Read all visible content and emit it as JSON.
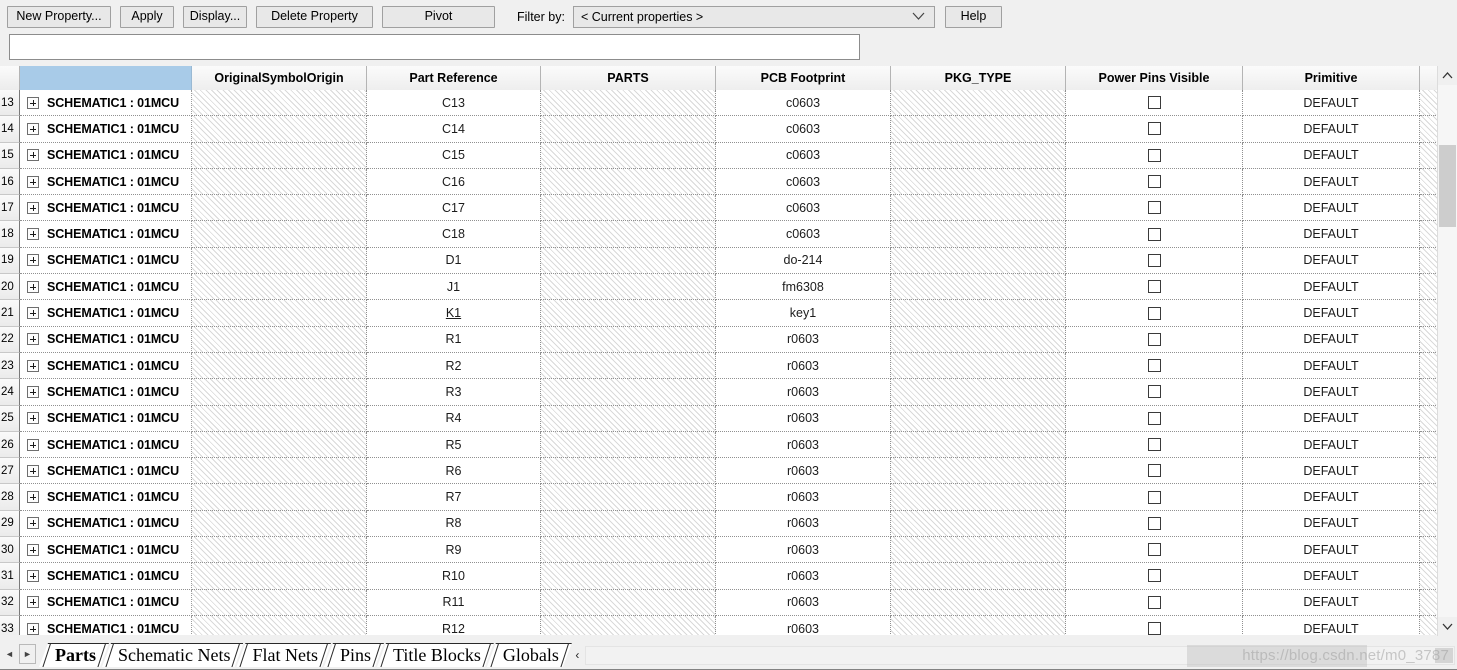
{
  "toolbar": {
    "new_property_label": "New Property...",
    "apply_label": "Apply",
    "display_label": "Display...",
    "delete_property_label": "Delete Property",
    "pivot_label": "Pivot",
    "filter_by_label": "Filter by:",
    "filter_value": "< Current properties >",
    "help_label": "Help"
  },
  "editbar": {
    "value": "",
    "placeholder": ""
  },
  "grid": {
    "columns": [
      {
        "key": "rownum",
        "label": ""
      },
      {
        "key": "name",
        "label": ""
      },
      {
        "key": "origin",
        "label": "OriginalSymbolOrigin"
      },
      {
        "key": "partref",
        "label": "Part Reference"
      },
      {
        "key": "parts",
        "label": "PARTS"
      },
      {
        "key": "footprint",
        "label": "PCB Footprint"
      },
      {
        "key": "pkgtype",
        "label": "PKG_TYPE"
      },
      {
        "key": "powerpins",
        "label": "Power Pins Visible"
      },
      {
        "key": "primitive",
        "label": "Primitive"
      }
    ],
    "rows": [
      {
        "num": "13",
        "name": "SCHEMATIC1 : 01MCU",
        "partref": "C13",
        "footprint": "c0603",
        "primitive": "DEFAULT",
        "selected": false
      },
      {
        "num": "14",
        "name": "SCHEMATIC1 : 01MCU",
        "partref": "C14",
        "footprint": "c0603",
        "primitive": "DEFAULT",
        "selected": false
      },
      {
        "num": "15",
        "name": "SCHEMATIC1 : 01MCU",
        "partref": "C15",
        "footprint": "c0603",
        "primitive": "DEFAULT",
        "selected": false
      },
      {
        "num": "16",
        "name": "SCHEMATIC1 : 01MCU",
        "partref": "C16",
        "footprint": "c0603",
        "primitive": "DEFAULT",
        "selected": false
      },
      {
        "num": "17",
        "name": "SCHEMATIC1 : 01MCU",
        "partref": "C17",
        "footprint": "c0603",
        "primitive": "DEFAULT",
        "selected": false
      },
      {
        "num": "18",
        "name": "SCHEMATIC1 : 01MCU",
        "partref": "C18",
        "footprint": "c0603",
        "primitive": "DEFAULT",
        "selected": false
      },
      {
        "num": "19",
        "name": "SCHEMATIC1 : 01MCU",
        "partref": "D1",
        "footprint": "do-214",
        "primitive": "DEFAULT",
        "selected": false
      },
      {
        "num": "20",
        "name": "SCHEMATIC1 : 01MCU",
        "partref": "J1",
        "footprint": "fm6308",
        "primitive": "DEFAULT",
        "selected": false
      },
      {
        "num": "21",
        "name": "SCHEMATIC1 : 01MCU",
        "partref": "K1",
        "footprint": "key1",
        "primitive": "DEFAULT",
        "selected": true
      },
      {
        "num": "22",
        "name": "SCHEMATIC1 : 01MCU",
        "partref": "R1",
        "footprint": "r0603",
        "primitive": "DEFAULT",
        "selected": false
      },
      {
        "num": "23",
        "name": "SCHEMATIC1 : 01MCU",
        "partref": "R2",
        "footprint": "r0603",
        "primitive": "DEFAULT",
        "selected": false
      },
      {
        "num": "24",
        "name": "SCHEMATIC1 : 01MCU",
        "partref": "R3",
        "footprint": "r0603",
        "primitive": "DEFAULT",
        "selected": false
      },
      {
        "num": "25",
        "name": "SCHEMATIC1 : 01MCU",
        "partref": "R4",
        "footprint": "r0603",
        "primitive": "DEFAULT",
        "selected": false
      },
      {
        "num": "26",
        "name": "SCHEMATIC1 : 01MCU",
        "partref": "R5",
        "footprint": "r0603",
        "primitive": "DEFAULT",
        "selected": false
      },
      {
        "num": "27",
        "name": "SCHEMATIC1 : 01MCU",
        "partref": "R6",
        "footprint": "r0603",
        "primitive": "DEFAULT",
        "selected": false
      },
      {
        "num": "28",
        "name": "SCHEMATIC1 : 01MCU",
        "partref": "R7",
        "footprint": "r0603",
        "primitive": "DEFAULT",
        "selected": false
      },
      {
        "num": "29",
        "name": "SCHEMATIC1 : 01MCU",
        "partref": "R8",
        "footprint": "r0603",
        "primitive": "DEFAULT",
        "selected": false
      },
      {
        "num": "30",
        "name": "SCHEMATIC1 : 01MCU",
        "partref": "R9",
        "footprint": "r0603",
        "primitive": "DEFAULT",
        "selected": false
      },
      {
        "num": "31",
        "name": "SCHEMATIC1 : 01MCU",
        "partref": "R10",
        "footprint": "r0603",
        "primitive": "DEFAULT",
        "selected": false
      },
      {
        "num": "32",
        "name": "SCHEMATIC1 : 01MCU",
        "partref": "R11",
        "footprint": "r0603",
        "primitive": "DEFAULT",
        "selected": false
      },
      {
        "num": "33",
        "name": "SCHEMATIC1 : 01MCU",
        "partref": "R12",
        "footprint": "r0603",
        "primitive": "DEFAULT",
        "selected": false
      }
    ]
  },
  "tabs": {
    "items": [
      {
        "label": "Parts",
        "active": true
      },
      {
        "label": "Schematic Nets",
        "active": false
      },
      {
        "label": "Flat Nets",
        "active": false
      },
      {
        "label": "Pins",
        "active": false
      },
      {
        "label": "Title Blocks",
        "active": false
      },
      {
        "label": "Globals",
        "active": false
      }
    ],
    "nav_prev": "◄",
    "nav_next": "►",
    "hscroll_left": "‹"
  },
  "watermark": {
    "text": "https://blog.csdn.net/m0_3787"
  },
  "colors": {
    "selected_header": "#a8cbe8",
    "toolbar_bg": "#f0f0f0",
    "grid_bg": "#ffffff",
    "scrollbar_thumb": "#cdcdcd"
  }
}
